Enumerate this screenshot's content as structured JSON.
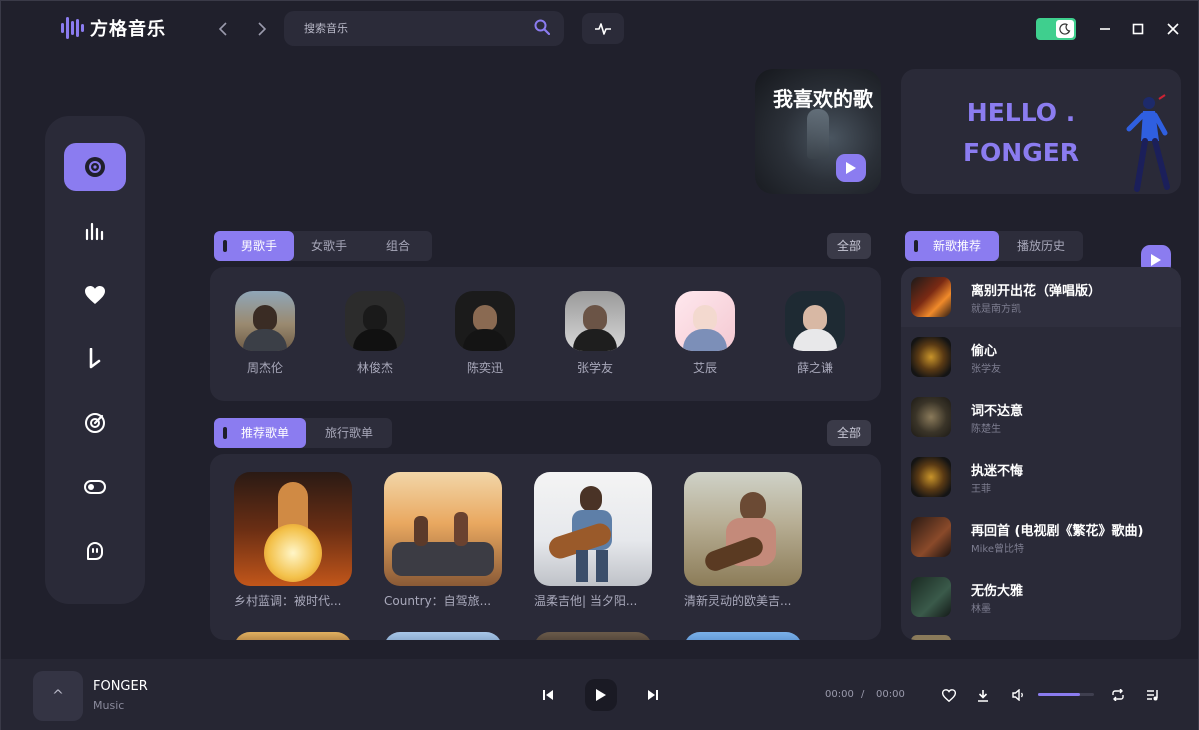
{
  "app": {
    "name": "方格音乐",
    "accent": "#8b7cf0",
    "background": "#1f1f2b",
    "panel": "#2a2a38"
  },
  "header": {
    "search_placeholder": "搜索音乐",
    "theme_toggle": "dark-mode-on",
    "icons": [
      "back-icon",
      "forward-icon",
      "search-icon",
      "waveform-icon",
      "moon-icon",
      "minimize-icon",
      "maximize-icon",
      "close-icon"
    ]
  },
  "sidebar": {
    "items": [
      {
        "icon": "disc-icon",
        "active": true
      },
      {
        "icon": "chart-bars-icon",
        "active": false
      },
      {
        "icon": "heart-icon",
        "active": false
      },
      {
        "icon": "music-note-icon",
        "active": false
      },
      {
        "icon": "radar-icon",
        "active": false
      },
      {
        "icon": "toggle-icon",
        "active": false
      },
      {
        "icon": "ghost-icon",
        "active": false
      }
    ]
  },
  "banner": {
    "favorites_title": "我喜欢的歌",
    "hello_line1": "HELLO .",
    "hello_line2": "FONGER"
  },
  "singers": {
    "tabs": [
      "男歌手",
      "女歌手",
      "组合"
    ],
    "active_tab": 0,
    "all_label": "全部",
    "list": [
      "周杰伦",
      "林俊杰",
      "陈奕迅",
      "张学友",
      "艾辰",
      "薛之谦"
    ]
  },
  "playlists": {
    "tabs": [
      "推荐歌单",
      "旅行歌单"
    ],
    "active_tab": 0,
    "all_label": "全部",
    "list": [
      "乡村蓝调：被时代...",
      "Country：自驾旅...",
      "温柔吉他| 当夕阳...",
      "清新灵动的欧美吉..."
    ]
  },
  "new_songs": {
    "tabs": [
      "新歌推荐",
      "播放历史"
    ],
    "active_tab": 0,
    "list": [
      {
        "title": "离别开出花（弹唱版）",
        "artist": "就是南方凯"
      },
      {
        "title": "偷心",
        "artist": "张学友"
      },
      {
        "title": "词不达意",
        "artist": "陈楚生"
      },
      {
        "title": "执迷不悔",
        "artist": "王菲"
      },
      {
        "title": "再回首 (电视剧《繁花》歌曲)",
        "artist": "Mike曾比特"
      },
      {
        "title": "无伤大雅",
        "artist": "林墨"
      }
    ]
  },
  "player": {
    "expand_label": "^",
    "title": "FONGER",
    "subtitle": "Music",
    "current_time": "00:00",
    "separator": "/",
    "duration": "00:00",
    "volume": 0.75,
    "icons": [
      "previous-icon",
      "play-icon",
      "next-icon",
      "like-icon",
      "download-icon",
      "volume-icon",
      "repeat-icon",
      "playlist-icon"
    ]
  }
}
